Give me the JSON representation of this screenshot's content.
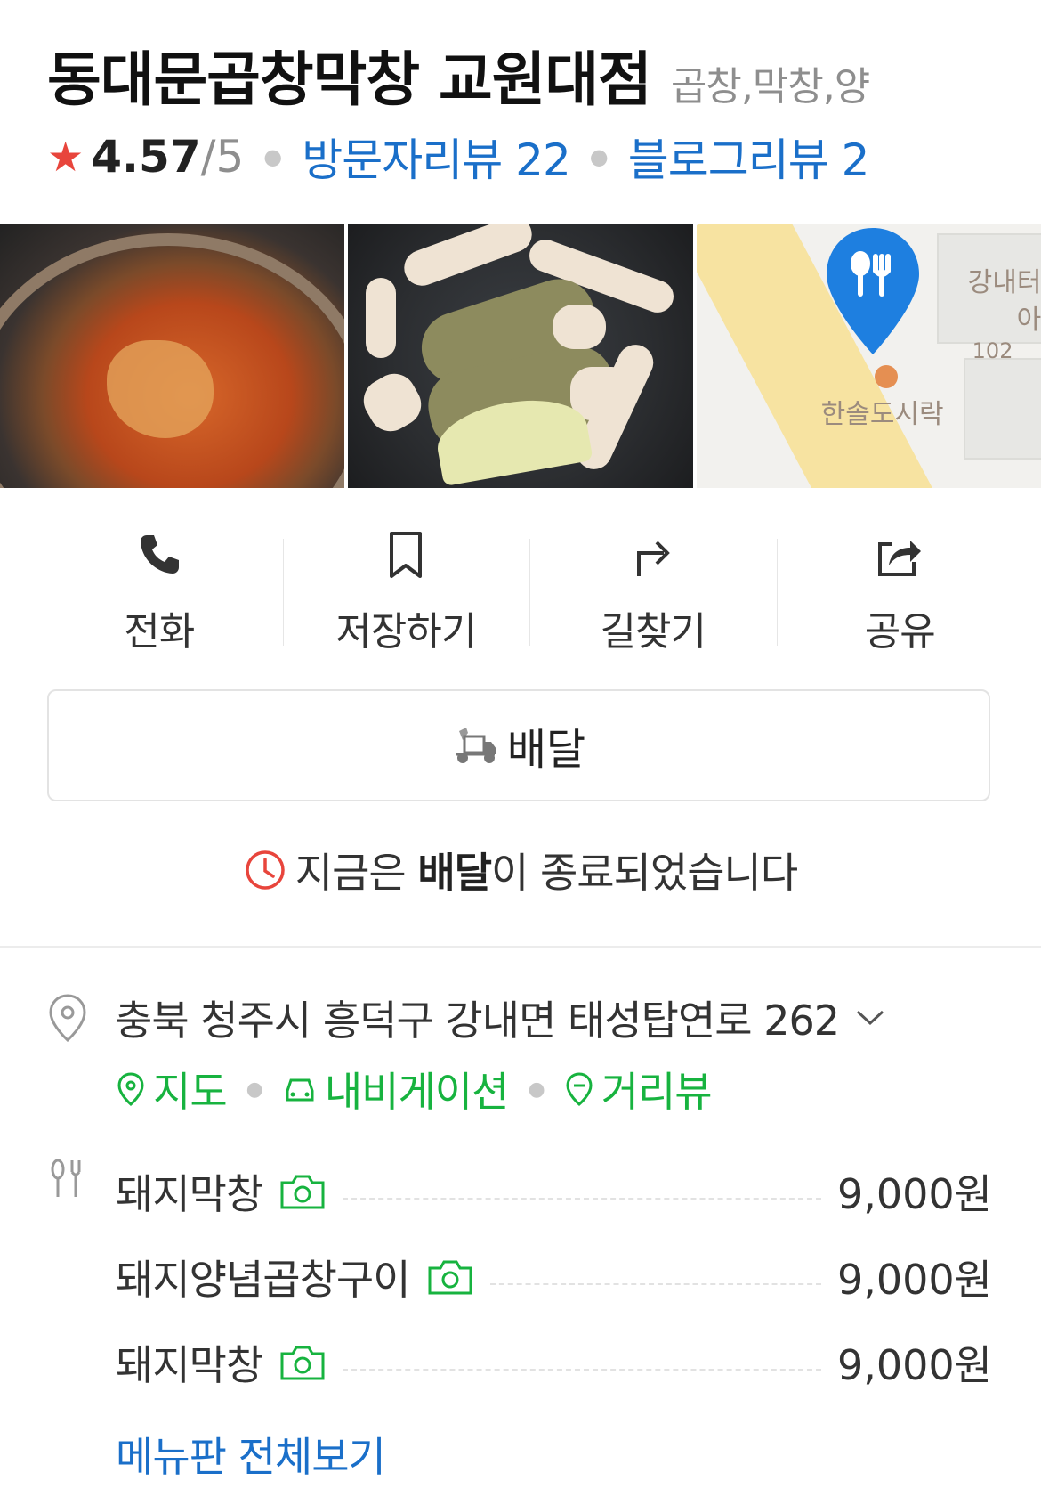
{
  "header": {
    "title": "동대문곱창막창 교원대점",
    "category": "곱창,막창,양"
  },
  "rating": {
    "star_icon": "star-icon",
    "score": "4.57",
    "max": "/5",
    "visitor_reviews": "방문자리뷰 22",
    "blog_reviews": "블로그리뷰 2"
  },
  "photos": {
    "map_labels": [
      "강내터",
      "아",
      "102",
      "한솔도시락"
    ]
  },
  "actions": [
    {
      "icon": "phone-icon",
      "label": "전화"
    },
    {
      "icon": "bookmark-icon",
      "label": "저장하기"
    },
    {
      "icon": "directions-icon",
      "label": "길찾기"
    },
    {
      "icon": "share-icon",
      "label": "공유"
    }
  ],
  "delivery": {
    "button_label": "배달",
    "status_prefix": "지금은 ",
    "status_bold": "배달",
    "status_suffix": "이 종료되었습니다"
  },
  "address": {
    "text": "충북 청주시 흥덕구 강내면 태성탑연로 262",
    "links": [
      "지도",
      "내비게이션",
      "거리뷰"
    ]
  },
  "menu": {
    "items": [
      {
        "name": "돼지막창",
        "price": "9,000원"
      },
      {
        "name": "돼지양념곱창구이",
        "price": "9,000원"
      },
      {
        "name": "돼지막창",
        "price": "9,000원"
      }
    ],
    "view_all": "메뉴판 전체보기"
  },
  "colors": {
    "link_blue": "#1a6fc9",
    "green": "#17b33f",
    "star_red": "#e8453c",
    "clock_red": "#e8453c"
  }
}
